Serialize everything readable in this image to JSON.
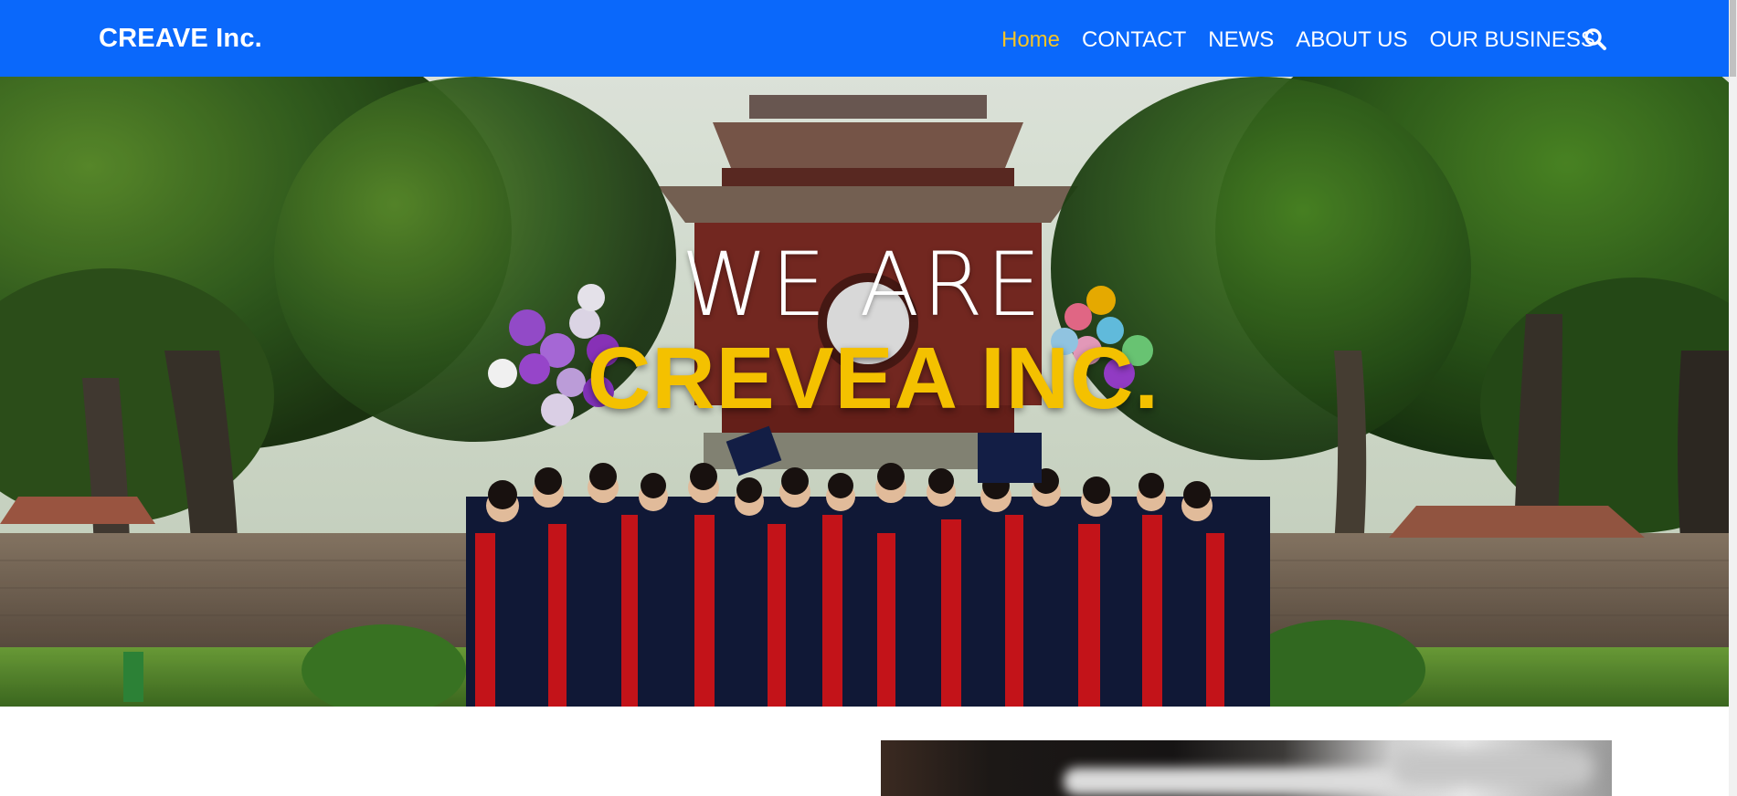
{
  "navbar": {
    "brand": "CREAVE Inc.",
    "items": [
      {
        "label": "Home",
        "active": true
      },
      {
        "label": "CONTACT",
        "active": false
      },
      {
        "label": "NEWS",
        "active": false
      },
      {
        "label": "ABOUT US",
        "active": false
      },
      {
        "label": "OUR BUSINESS",
        "active": false
      }
    ],
    "search_icon": "search-icon",
    "colors": {
      "background": "#0a68fb",
      "active": "#f4c326",
      "text": "#ffffff"
    }
  },
  "hero": {
    "line1": "WE ARE",
    "line2": "CREVEA INC.",
    "colors": {
      "line1": "#ffffff",
      "line2": "#f4c100"
    }
  }
}
